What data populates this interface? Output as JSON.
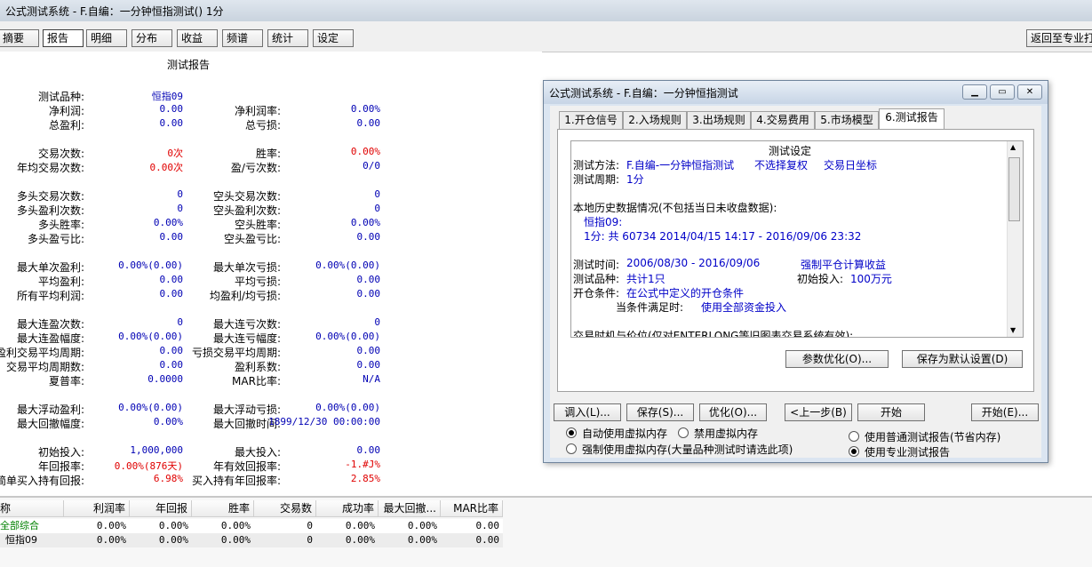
{
  "window_title": "公式测试系统 - F.自编：一分钟恒指测试() 1分",
  "top_tabs": [
    "摘要",
    "报告",
    "明细",
    "分布",
    "收益",
    "频谱",
    "统计",
    "设定"
  ],
  "return_button": "返回至专业打",
  "report": {
    "title": "测试报告",
    "rows": [
      {
        "l1": "测试品种:",
        "v1": "恒指09",
        "l2": "",
        "v2": ""
      },
      {
        "l1": "净利润:",
        "v1": "0.00",
        "l2": "净利润率:",
        "v2": "0.00%"
      },
      {
        "l1": "总盈利:",
        "v1": "0.00",
        "l2": "总亏损:",
        "v2": "0.00"
      },
      {
        "l1": "交易次数:",
        "v1": "0次",
        "l2": "胜率:",
        "v2": "0.00%"
      },
      {
        "l1": "年均交易次数:",
        "v1": "0.00次",
        "l2": "盈/亏次数:",
        "v2": "0/0"
      },
      {
        "l1": "多头交易次数:",
        "v1": "0",
        "l2": "空头交易次数:",
        "v2": "0"
      },
      {
        "l1": "多头盈利次数:",
        "v1": "0",
        "l2": "空头盈利次数:",
        "v2": "0"
      },
      {
        "l1": "多头胜率:",
        "v1": "0.00%",
        "l2": "空头胜率:",
        "v2": "0.00%"
      },
      {
        "l1": "多头盈亏比:",
        "v1": "0.00",
        "l2": "空头盈亏比:",
        "v2": "0.00"
      },
      {
        "l1": "最大单次盈利:",
        "v1": "0.00%(0.00)",
        "l2": "最大单次亏损:",
        "v2": "0.00%(0.00)"
      },
      {
        "l1": "平均盈利:",
        "v1": "0.00",
        "l2": "平均亏损:",
        "v2": "0.00"
      },
      {
        "l1": "所有平均利润:",
        "v1": "0.00",
        "l2": "均盈利/均亏损:",
        "v2": "0.00"
      },
      {
        "l1": "最大连盈次数:",
        "v1": "0",
        "l2": "最大连亏次数:",
        "v2": "0"
      },
      {
        "l1": "最大连盈幅度:",
        "v1": "0.00%(0.00)",
        "l2": "最大连亏幅度:",
        "v2": "0.00%(0.00)"
      },
      {
        "l1": "盈利交易平均周期:",
        "v1": "0.00",
        "l2": "亏损交易平均周期:",
        "v2": "0.00"
      },
      {
        "l1": "交易平均周期数:",
        "v1": "0.00",
        "l2": "盈利系数:",
        "v2": "0.00"
      },
      {
        "l1": "夏普率:",
        "v1": "0.0000",
        "l2": "MAR比率:",
        "v2": "N/A"
      },
      {
        "l1": "最大浮动盈利:",
        "v1": "0.00%(0.00)",
        "l2": "最大浮动亏损:",
        "v2": "0.00%(0.00)"
      },
      {
        "l1": "最大回撤幅度:",
        "v1": "0.00%",
        "l2": "最大回撤时间:",
        "v2": "1899/12/30 00:00:00"
      },
      {
        "l1": "初始投入:",
        "v1": "1,000,000",
        "l2": "最大投入:",
        "v2": "0.00"
      },
      {
        "l1": "年回报率:",
        "v1": "0.00%(876天)",
        "l2": "年有效回报率:",
        "v2": "-1.#J%"
      },
      {
        "l1": "简单买入持有回报:",
        "v1": "6.98%",
        "l2": "买入持有年回报率:",
        "v2": "2.85%"
      }
    ]
  },
  "table": {
    "headers": [
      "称",
      "利润率",
      "年回报",
      "胜率",
      "交易数",
      "成功率",
      "最大回撤...",
      "MAR比率"
    ],
    "rows": [
      {
        "name": "全部综合",
        "cells": [
          "0.00%",
          "0.00%",
          "0.00%",
          "0",
          "0.00%",
          "0.00%",
          "0.00"
        ]
      },
      {
        "name": "恒指09",
        "cells": [
          "0.00%",
          "0.00%",
          "0.00%",
          "0",
          "0.00%",
          "0.00%",
          "0.00"
        ]
      }
    ]
  },
  "dialog": {
    "title": "公式测试系统 - F.自编：一分钟恒指测试",
    "tabs": [
      "1.开仓信号",
      "2.入场规则",
      "3.出场规则",
      "4.交易费用",
      "5.市场模型",
      "6.测试报告"
    ],
    "settings": {
      "heading": "测试设定",
      "method_label": "测试方法:",
      "method_value": "F.自编-一分钟恒指测试",
      "no_rights": "不选择复权",
      "day_axis": "交易日坐标",
      "period_label": "测试周期:",
      "period_value": "1分",
      "history_label": "本地历史数据情况(不包括当日未收盘数据):",
      "history_name": "恒指09:",
      "history_range": "1分: 共 60734 2014/04/15 14:17 - 2016/09/06 23:32",
      "time_label": "测试时间:",
      "time_value": "2006/08/30 - 2016/09/06",
      "force_close": "强制平仓计算收益",
      "variety_label": "测试品种:",
      "variety_value": "共计1只",
      "initial_label": "初始投入:",
      "initial_value": "100万元",
      "open_label": "开仓条件:",
      "open_value": "在公式中定义的开仓条件",
      "cond_label": "当条件满足时:",
      "cond_value": "使用全部资金投入",
      "timing_label": "交易时机与价位(仅对ENTERLONG等旧图表交易系统有效):"
    },
    "btn_param": "参数优化(O)...",
    "btn_save_default": "保存为默认设置(D)",
    "btn_load": "调入(L)...",
    "btn_save": "保存(S)...",
    "btn_opt": "优化(O)...",
    "btn_prev": "<上一步(B)",
    "btn_start": "开始",
    "btn_start_e": "开始(E)...",
    "radio_auto": "自动使用虚拟内存",
    "radio_disable": "禁用虚拟内存",
    "radio_force": "强制使用虚拟内存(大量品种测试时请选此项)",
    "radio_normal_report": "使用普通测试报告(节省内存)",
    "radio_pro_report": "使用专业测试报告"
  }
}
